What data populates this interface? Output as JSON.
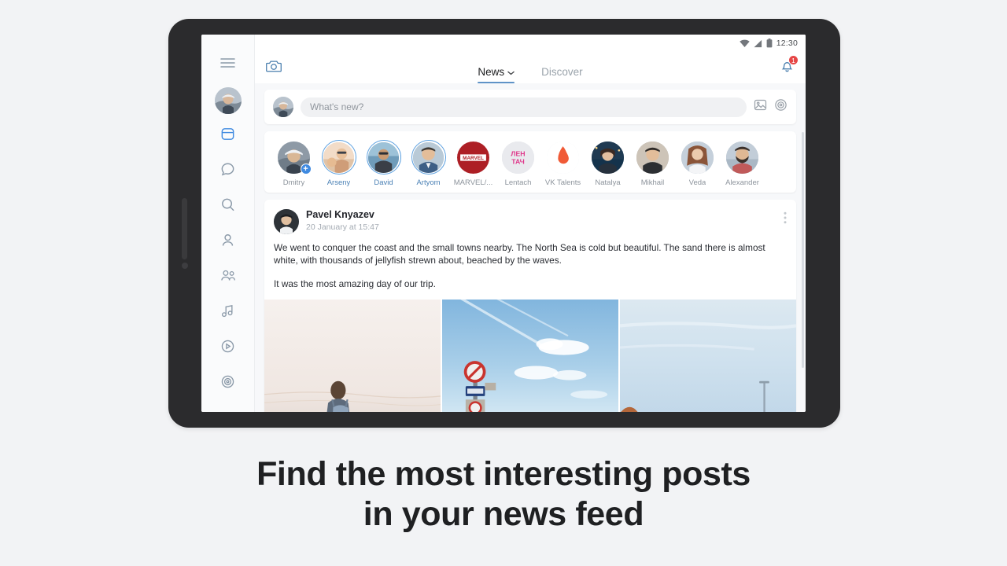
{
  "caption": {
    "line1": "Find the most interesting posts",
    "line2": "in your news feed"
  },
  "statusbar": {
    "wifi_icon": "wifi-icon",
    "signal_icon": "cellular-signal-icon",
    "battery_icon": "battery-icon",
    "time": "12:30"
  },
  "rail": {
    "menu_icon": "hamburger-menu-icon",
    "avatar_icon": "user-avatar",
    "items": [
      {
        "icon": "news-feed-icon",
        "label": "News",
        "active": true
      },
      {
        "icon": "messages-icon",
        "label": "Messages",
        "active": false
      },
      {
        "icon": "search-icon",
        "label": "Search",
        "active": false
      },
      {
        "icon": "profile-icon",
        "label": "Profile",
        "active": false
      },
      {
        "icon": "friends-icon",
        "label": "Friends",
        "active": false
      },
      {
        "icon": "music-icon",
        "label": "Music",
        "active": false
      },
      {
        "icon": "video-icon",
        "label": "Video",
        "active": false
      },
      {
        "icon": "target-icon",
        "label": "Services",
        "active": false
      }
    ]
  },
  "topnav": {
    "camera_icon": "camera-icon",
    "tabs": [
      {
        "label": "News",
        "active": true,
        "chevron": "chevron-down-icon"
      },
      {
        "label": "Discover",
        "active": false,
        "chevron": ""
      }
    ],
    "bell_icon": "notification-bell-icon",
    "notification_count": "1"
  },
  "composer": {
    "avatar": "user-avatar",
    "placeholder": "What's new?",
    "value": "",
    "photo_icon": "photo-icon",
    "target_icon": "target-icon"
  },
  "stories": [
    {
      "name": "Dmitry",
      "unseen": false,
      "add": true,
      "kind": "photo-man-hat",
      "bg": "#8e9aa6"
    },
    {
      "name": "Arseny",
      "unseen": true,
      "add": false,
      "kind": "photo-beach",
      "bg": "#e3c9b6"
    },
    {
      "name": "David",
      "unseen": true,
      "add": false,
      "kind": "photo-sea",
      "bg": "#7fa6bf"
    },
    {
      "name": "Artyom",
      "unseen": true,
      "add": false,
      "kind": "photo-portrait",
      "bg": "#9fb5c6"
    },
    {
      "name": "MARVEL/...",
      "unseen": false,
      "add": false,
      "kind": "logo-marvel",
      "bg": "#b11f24"
    },
    {
      "name": "Lentach",
      "unseen": false,
      "add": false,
      "kind": "logo-lentach",
      "bg": "#e8e9ed"
    },
    {
      "name": "VK Talents",
      "unseen": false,
      "add": false,
      "kind": "logo-flame",
      "bg": "#ffffff"
    },
    {
      "name": "Natalya",
      "unseen": false,
      "add": false,
      "kind": "photo-night",
      "bg": "#2b4a63"
    },
    {
      "name": "Mikhail",
      "unseen": false,
      "add": false,
      "kind": "photo-grey",
      "bg": "#b6ada3"
    },
    {
      "name": "Veda",
      "unseen": false,
      "add": false,
      "kind": "photo-woman",
      "bg": "#b8c3cf"
    },
    {
      "name": "Alexander",
      "unseen": false,
      "add": false,
      "kind": "photo-beard",
      "bg": "#a9b6c2"
    }
  ],
  "post": {
    "author": "Pavel Knyazev",
    "date": "20 January at 15:47",
    "menu_icon": "more-options-icon",
    "paragraph1": "We went to conquer the coast and the small towns nearby. The North Sea is cold but beautiful. The sand there is almost white, with thousands of jellyfish strewn about, beached by the waves.",
    "paragraph2": "It was the most amazing day of our trip.",
    "photos": [
      {
        "alt": "person-with-backpack-on-beach"
      },
      {
        "alt": "road-sign-against-blue-sky"
      },
      {
        "alt": "sky-with-lamppost"
      }
    ]
  },
  "colors": {
    "accent": "#3f8ae0",
    "badge": "#e64646",
    "page_bg": "#f2f3f5",
    "frame": "#2b2b2d",
    "text": "#1f2022"
  }
}
